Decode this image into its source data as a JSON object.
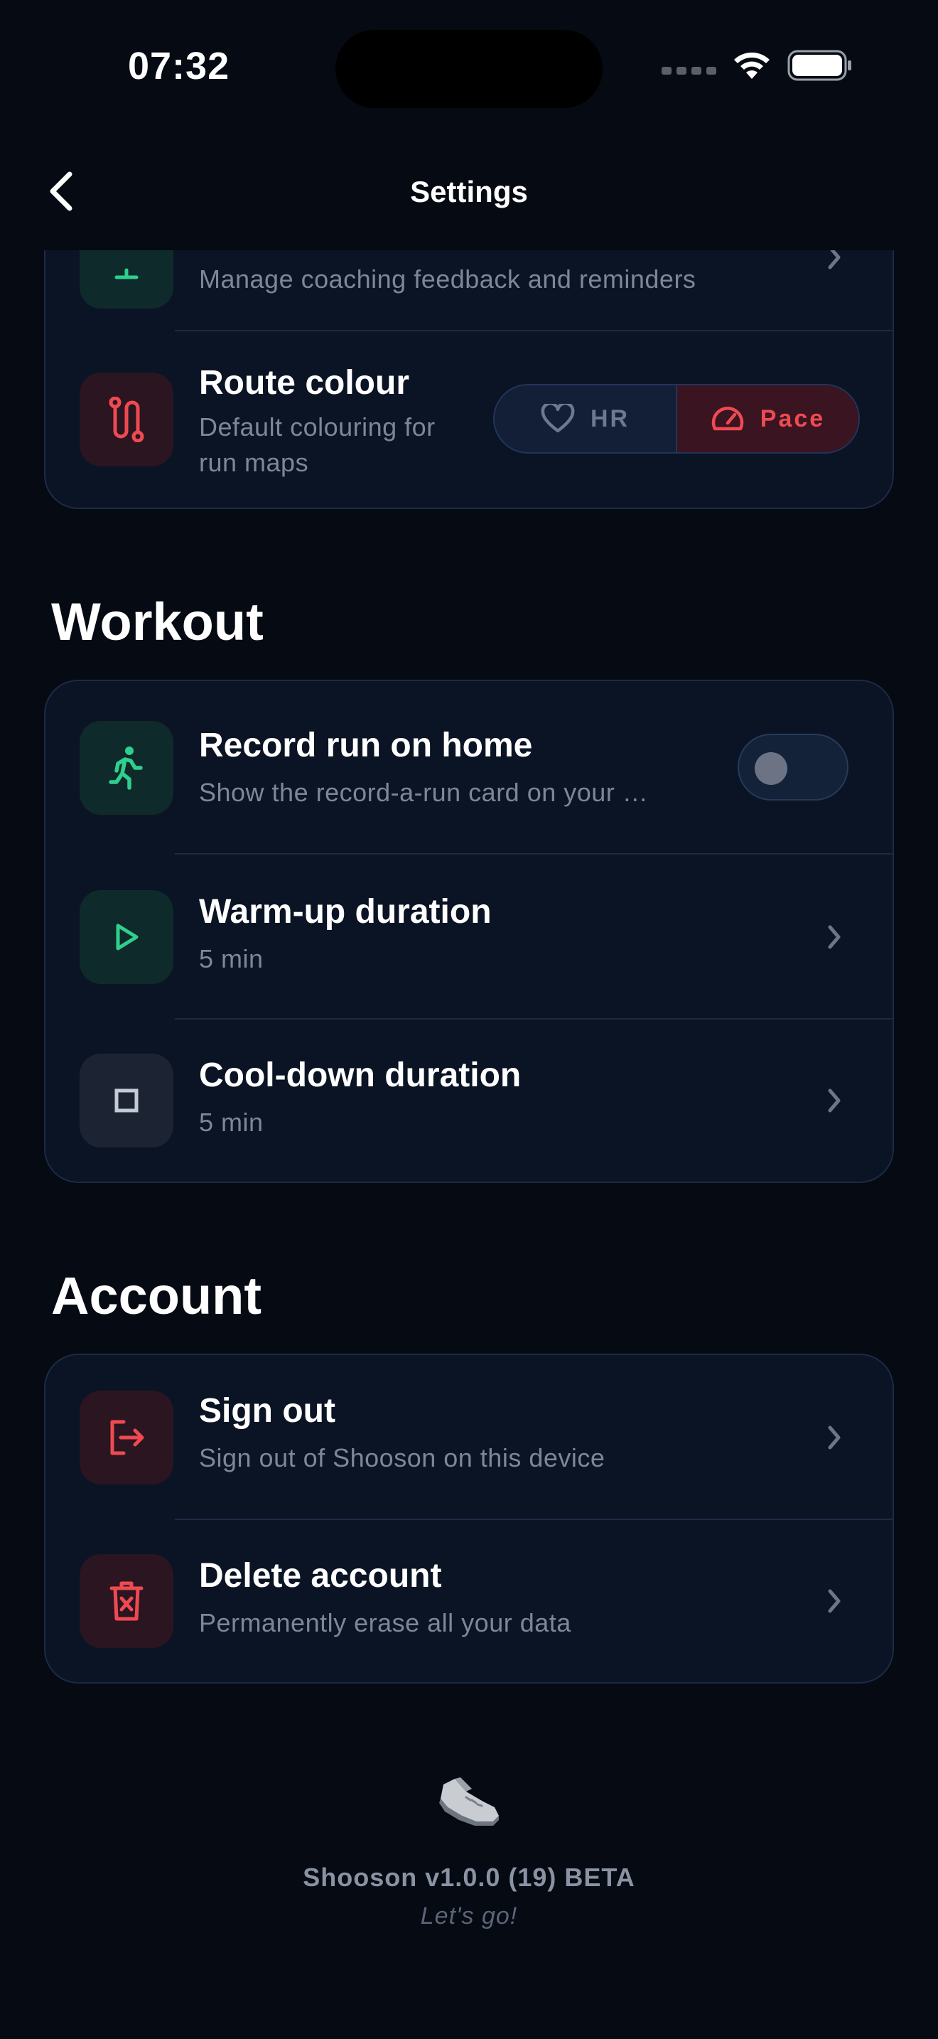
{
  "status_bar": {
    "time": "07:32",
    "icons": [
      "signal-icon",
      "wifi-icon",
      "battery-icon"
    ]
  },
  "nav": {
    "title": "Settings",
    "back_icon": "chevron-left-icon"
  },
  "top_card": {
    "items": [
      {
        "title": "",
        "subtitle": "Manage coaching feedback and reminders",
        "icon": "bell-icon"
      },
      {
        "title": "Route colour",
        "subtitle_line1": "Default colouring for",
        "subtitle_line2": "run maps",
        "icon": "route-icon",
        "segmented": {
          "options": [
            {
              "label": "HR",
              "icon": "heart-icon"
            },
            {
              "label": "Pace",
              "icon": "speedometer-icon"
            }
          ],
          "selected": "Pace"
        }
      }
    ]
  },
  "workout": {
    "section_title": "Workout",
    "items": [
      {
        "title": "Record run on home",
        "subtitle": "Show the record-a-run card on your …",
        "icon": "running-person-icon",
        "toggle_on": false
      },
      {
        "title": "Warm-up duration",
        "subtitle": "5 min",
        "icon": "play-icon"
      },
      {
        "title": "Cool-down duration",
        "subtitle": "5 min",
        "icon": "stop-icon"
      }
    ]
  },
  "account": {
    "section_title": "Account",
    "items": [
      {
        "title": "Sign out",
        "subtitle": "Sign out of Shooson on this device",
        "icon": "sign-out-icon"
      },
      {
        "title": "Delete account",
        "subtitle": "Permanently erase all your data",
        "icon": "trash-icon"
      }
    ]
  },
  "footer": {
    "version": "Shooson v1.0.0 (19) BETA",
    "tagline": "Let's go!",
    "logo_icon": "shoe-icon"
  },
  "colors": {
    "background": "#050a13",
    "card": "#0b1424",
    "accent_green": "#2ecf8f",
    "accent_red": "#ef4a52",
    "muted_text": "#7c8798"
  }
}
